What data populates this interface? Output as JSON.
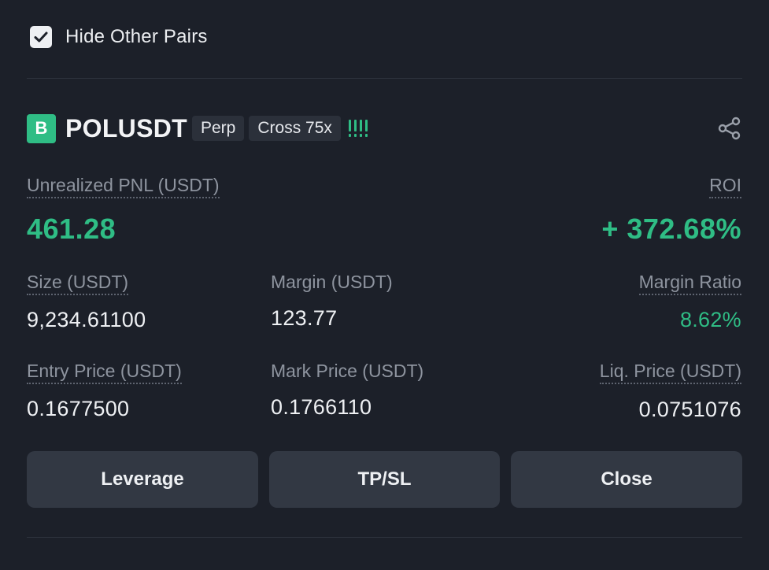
{
  "filter": {
    "checked": true,
    "label": "Hide Other Pairs"
  },
  "position": {
    "side_badge": "B",
    "symbol": "POLUSDT",
    "type_tag": "Perp",
    "margin_tag": "Cross 75x",
    "risk_level": 4,
    "risk_bars_total": 4,
    "unrealized_pnl_label": "Unrealized PNL (USDT)",
    "unrealized_pnl_value": "461.28",
    "roi_label": "ROI",
    "roi_value": "+ 372.68%",
    "size_label": "Size (USDT)",
    "size_value": "9,234.61100",
    "margin_label": "Margin (USDT)",
    "margin_value": "123.77",
    "margin_ratio_label": "Margin Ratio",
    "margin_ratio_value": "8.62%",
    "entry_price_label": "Entry Price (USDT)",
    "entry_price_value": "0.1677500",
    "mark_price_label": "Mark Price (USDT)",
    "mark_price_value": "0.1766110",
    "liq_price_label": "Liq. Price (USDT)",
    "liq_price_value": "0.0751076"
  },
  "actions": {
    "leverage_label": "Leverage",
    "tpsl_label": "TP/SL",
    "close_label": "Close"
  },
  "colors": {
    "background": "#1c2029",
    "positive": "#2fbd85",
    "button_bg": "#323843",
    "muted_text": "#8e949f"
  },
  "icons": {
    "checkbox": "checkmark-icon",
    "share": "share-icon"
  }
}
